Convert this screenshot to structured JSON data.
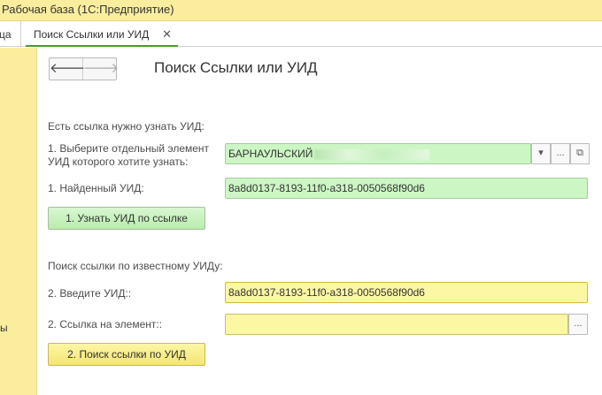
{
  "window": {
    "title": "Рабочая база  (1С:Предприятие)"
  },
  "tabs": {
    "prev_fragment": "ца",
    "active_label": "Поиск Ссылки или УИД",
    "close_glyph": "✕"
  },
  "sidebar": {
    "text_fragment": "ы"
  },
  "nav": {
    "back_glyph": "🡐",
    "forward_glyph": "🡒"
  },
  "form": {
    "title": "Поиск Ссылки или УИД",
    "section1": {
      "heading": "Есть ссылка нужно узнать УИД:",
      "element_label_line1": "1. Выберите отдельный элемент",
      "element_label_line2": "УИД которого хотите узнать:",
      "element_value": "БАРНАУЛЬСКИЙ",
      "found_label": "1. Найденный УИД:",
      "found_value": "8a8d0137-8193-11f0-a318-0050568f90d6",
      "button_label": "1. Узнать УИД по ссылке"
    },
    "section2": {
      "heading": "Поиск ссылки по известному УИДу:",
      "uid_label": "2. Введите УИД::",
      "uid_value": "8a8d0137-8193-11f0-a318-0050568f90d6",
      "ref_label": "2. Ссылка на элемент::",
      "ref_value": "",
      "button_label": "2. Поиск ссылки по УИД"
    },
    "buttons": {
      "dropdown": "▾",
      "more": "...",
      "open": "⧉"
    }
  },
  "colors": {
    "accent_green": "#4c9a2a",
    "field_green": "#ccf7c4",
    "field_yellow": "#fbf7a2",
    "panel_yellow": "#fbed9e"
  }
}
